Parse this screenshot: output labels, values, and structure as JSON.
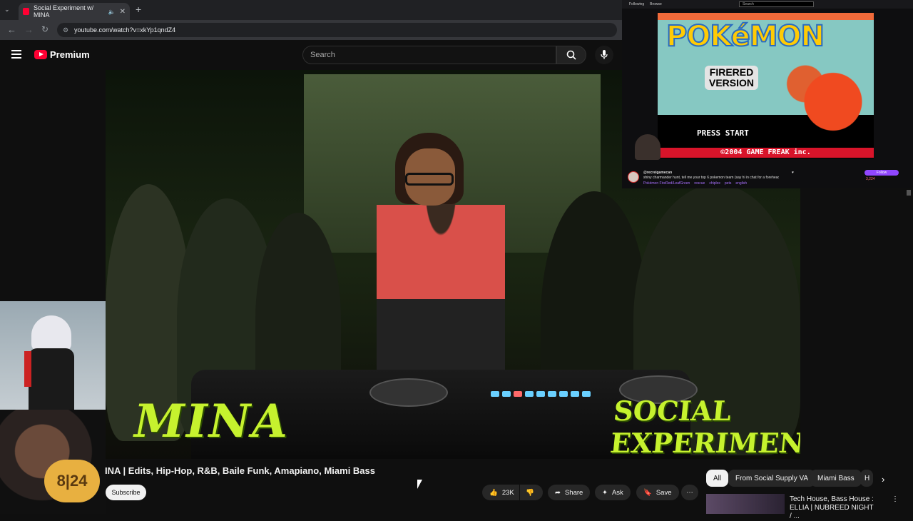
{
  "browser": {
    "tab_title": "Social Experiment w/ MINA",
    "url": "youtube.com/watch?v=xkYp1qndZ4"
  },
  "youtube": {
    "logo_text": "Premium",
    "search_placeholder": "Search",
    "video": {
      "overlay_left": "MINA",
      "overlay_right": "SOCIAL EXPERIMENT"
    },
    "title": "INA | Edits, Hip-Hop, R&B, Baile Funk, Amapiano, Miami Bass",
    "subscribe_label": "Subscribe",
    "actions": {
      "likes": "23K",
      "share": "Share",
      "ask": "Ask",
      "save": "Save"
    },
    "chips": [
      "All",
      "From Social Supply VA",
      "Miami Bass",
      "H"
    ],
    "recommendation": {
      "title_line1": "Tech House, Bass House :",
      "title_line2": "ELLIA | NUBREED NIGHT / ..."
    }
  },
  "stream_panel": {
    "top_links": [
      "Following",
      "Browse"
    ],
    "search_placeholder": "Search",
    "game": {
      "logo": "POKéMON",
      "subtitle_line1": "FIRERED",
      "subtitle_line2": "VERSION",
      "press_start": "PRESS START",
      "copyright": "©2004 GAME FREAK inc."
    },
    "channel_name": "@recreigamecan",
    "stream_title": "shiny charmander hunt, tell me your top 6 pokemon team (say hi in chat for a forehead kiss)",
    "tags": [
      "Pokémon FireRed/LeafGreen",
      "rescue",
      "chiplox",
      "pets",
      "english"
    ],
    "follow_label": "Follow",
    "viewer_count": "3,224"
  },
  "colors": {
    "yt_red": "#ff0033",
    "overlay_green": "#c6f22e",
    "twitch_purple": "#9147ff"
  }
}
